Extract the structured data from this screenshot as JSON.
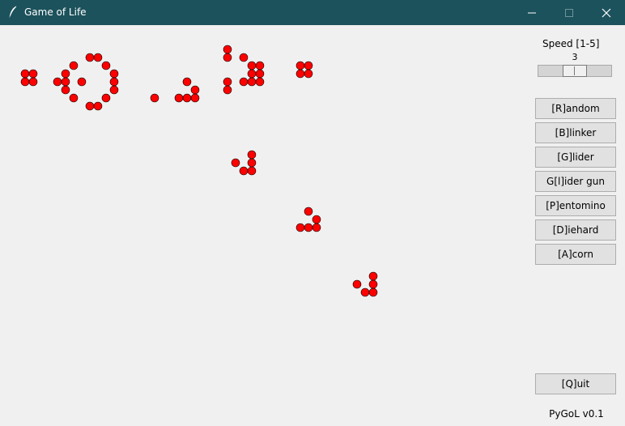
{
  "window": {
    "title": "Game of Life",
    "app_icon": "feather-icon",
    "controls": [
      "minimize-icon",
      "maximize-icon",
      "close-icon"
    ],
    "titlebar_color": "#1c525c"
  },
  "sidebar": {
    "speed_label": "Speed [1-5]",
    "speed_value": "3",
    "speed": {
      "value": 3,
      "min": 1,
      "max": 5
    },
    "buttons": [
      {
        "key": "random",
        "label": "[R]andom"
      },
      {
        "key": "blinker",
        "label": "[B]linker"
      },
      {
        "key": "glider",
        "label": "[G]lider"
      },
      {
        "key": "glider-gun",
        "label": "G[l]ider gun"
      },
      {
        "key": "pentomino",
        "label": "[P]entomino"
      },
      {
        "key": "diehard",
        "label": "[D]iehard"
      },
      {
        "key": "acorn",
        "label": "[A]corn"
      }
    ],
    "quit_label": "[Q]uit",
    "version": "PyGoL v0.1"
  },
  "board": {
    "cell_color": "#ff0000",
    "live_cells": [
      [
        1,
        5
      ],
      [
        2,
        5
      ],
      [
        1,
        6
      ],
      [
        2,
        6
      ],
      [
        9,
        3
      ],
      [
        10,
        3
      ],
      [
        7,
        4
      ],
      [
        11,
        4
      ],
      [
        6,
        5
      ],
      [
        12,
        5
      ],
      [
        5,
        6
      ],
      [
        6,
        6
      ],
      [
        8,
        6
      ],
      [
        12,
        6
      ],
      [
        6,
        7
      ],
      [
        12,
        7
      ],
      [
        7,
        8
      ],
      [
        11,
        8
      ],
      [
        9,
        9
      ],
      [
        10,
        9
      ],
      [
        17,
        8
      ],
      [
        21,
        6
      ],
      [
        22,
        7
      ],
      [
        20,
        8
      ],
      [
        21,
        8
      ],
      [
        22,
        8
      ],
      [
        26,
        2
      ],
      [
        26,
        3
      ],
      [
        28,
        3
      ],
      [
        29,
        4
      ],
      [
        30,
        4
      ],
      [
        29,
        5
      ],
      [
        30,
        5
      ],
      [
        29,
        6
      ],
      [
        30,
        6
      ],
      [
        26,
        6
      ],
      [
        28,
        6
      ],
      [
        26,
        7
      ],
      [
        35,
        4
      ],
      [
        36,
        4
      ],
      [
        35,
        5
      ],
      [
        36,
        5
      ],
      [
        29,
        15
      ],
      [
        27,
        16
      ],
      [
        29,
        16
      ],
      [
        28,
        17
      ],
      [
        29,
        17
      ],
      [
        36,
        22
      ],
      [
        37,
        23
      ],
      [
        35,
        24
      ],
      [
        36,
        24
      ],
      [
        37,
        24
      ],
      [
        44,
        30
      ],
      [
        42,
        31
      ],
      [
        44,
        31
      ],
      [
        43,
        32
      ],
      [
        44,
        32
      ]
    ]
  }
}
